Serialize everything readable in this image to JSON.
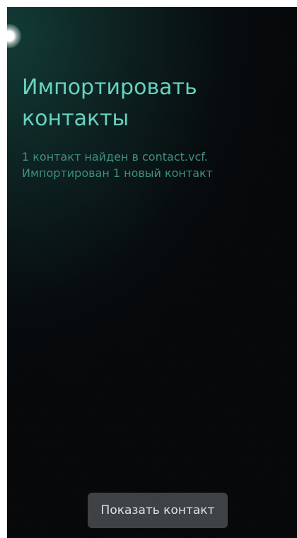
{
  "dialog": {
    "title_line1": "Импортировать",
    "title_line2": "контакты",
    "message_line1": "1 контакт найден в contact.vcf.",
    "message_line2": "Импортирован 1 новый контакт",
    "show_contact_label": "Показать контакт"
  },
  "colors": {
    "accent": "#66d3c0",
    "secondary_text": "#3f8f82",
    "background": "#06090b"
  },
  "icons": {
    "pulley_indicator": "glow-dot"
  }
}
